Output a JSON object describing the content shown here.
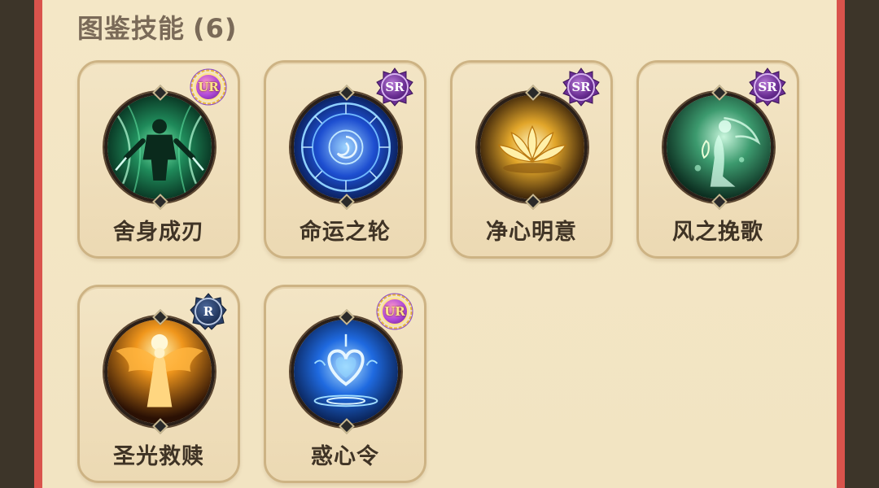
{
  "section": {
    "title": "图鉴技能",
    "count": "(6)"
  },
  "colors": {
    "panel_bg": "#f4e7c6",
    "frame_red": "#d9534c",
    "card_border": "#cdb384",
    "title_text": "#7a6a58",
    "name_text": "#3f3325"
  },
  "skills": [
    {
      "name": "舍身成刃",
      "rarity": "UR",
      "icon": "green-warrior-blades-icon"
    },
    {
      "name": "命运之轮",
      "rarity": "SR",
      "icon": "blue-wheel-of-fate-icon"
    },
    {
      "name": "净心明意",
      "rarity": "SR",
      "icon": "golden-lotus-icon"
    },
    {
      "name": "风之挽歌",
      "rarity": "SR",
      "icon": "green-wind-bard-icon"
    },
    {
      "name": "圣光救赎",
      "rarity": "R",
      "icon": "golden-winged-saint-icon"
    },
    {
      "name": "惑心令",
      "rarity": "UR",
      "icon": "blue-heart-ripple-icon"
    }
  ]
}
